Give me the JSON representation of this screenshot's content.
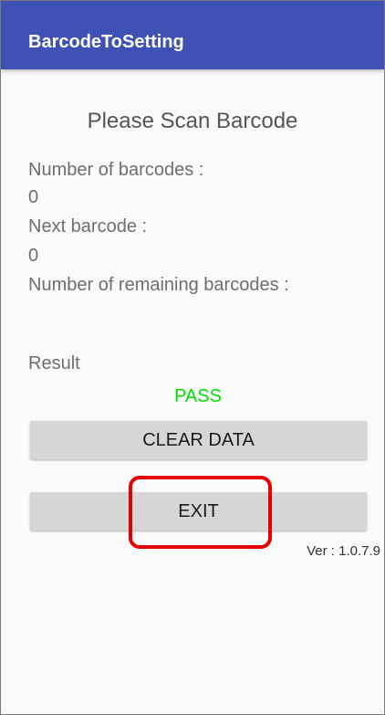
{
  "app": {
    "title": "BarcodeToSetting"
  },
  "main": {
    "heading": "Please Scan Barcode",
    "number_of_barcodes_label": "Number of barcodes :",
    "number_of_barcodes_value": "0",
    "next_barcode_label": "Next barcode :",
    "next_barcode_value": "0",
    "remaining_barcodes_label": "Number of remaining barcodes :",
    "result_label": "Result",
    "result_value": "PASS"
  },
  "buttons": {
    "clear_data": "CLEAR DATA",
    "exit": "EXIT"
  },
  "footer": {
    "version": "Ver : 1.0.7.9"
  },
  "colors": {
    "app_bar": "#3f51b5",
    "pass_text": "#00e000",
    "highlight": "#e60000",
    "button_bg": "#d6d6d6"
  }
}
